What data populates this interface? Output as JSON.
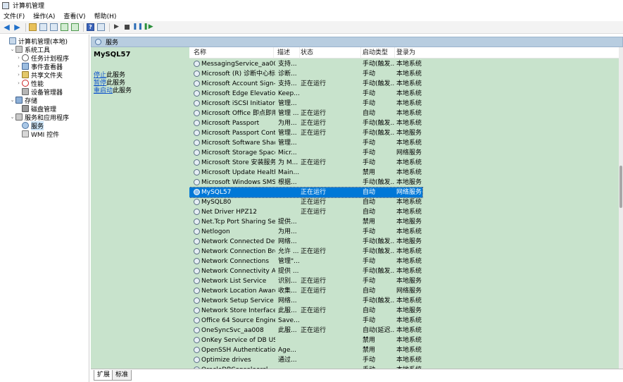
{
  "window": {
    "title": "计算机管理"
  },
  "menu": [
    "文件(F)",
    "操作(A)",
    "查看(V)",
    "帮助(H)"
  ],
  "toolbar": {
    "icons": [
      "back-arrow-icon",
      "forward-arrow-icon",
      "up-folder-icon",
      "console-tree-icon",
      "properties-icon",
      "refresh-icon",
      "export-icon",
      "help-icon",
      "view-icon",
      "start-service-icon",
      "stop-service-icon",
      "pause-service-icon",
      "restart-service-icon"
    ]
  },
  "tree": [
    {
      "label": "计算机管理(本地)",
      "level": 0,
      "twisty": "",
      "icon": "computer-icon"
    },
    {
      "label": "系统工具",
      "level": 1,
      "twisty": "v",
      "icon": "tools-icon"
    },
    {
      "label": "任务计划程序",
      "level": 2,
      "twisty": ">",
      "icon": "task-scheduler-icon"
    },
    {
      "label": "事件查看器",
      "level": 2,
      "twisty": ">",
      "icon": "event-viewer-icon"
    },
    {
      "label": "共享文件夹",
      "level": 2,
      "twisty": ">",
      "icon": "shared-folder-icon"
    },
    {
      "label": "性能",
      "level": 2,
      "twisty": ">",
      "icon": "performance-icon"
    },
    {
      "label": "设备管理器",
      "level": 2,
      "twisty": "",
      "icon": "device-manager-icon"
    },
    {
      "label": "存储",
      "level": 1,
      "twisty": "v",
      "icon": "storage-icon"
    },
    {
      "label": "磁盘管理",
      "level": 2,
      "twisty": "",
      "icon": "disk-management-icon"
    },
    {
      "label": "服务和应用程序",
      "level": 1,
      "twisty": "v",
      "icon": "services-apps-icon"
    },
    {
      "label": "服务",
      "level": 2,
      "twisty": "",
      "icon": "services-icon",
      "selected": true
    },
    {
      "label": "WMI 控件",
      "level": 2,
      "twisty": "",
      "icon": "wmi-icon"
    }
  ],
  "content_header": {
    "title": "服务"
  },
  "description": {
    "service_name": "MySQL57",
    "actions": [
      {
        "link": "停止",
        "rest": "此服务"
      },
      {
        "link": "暂停",
        "rest": "此服务"
      },
      {
        "link": "重启动",
        "rest": "此服务"
      }
    ]
  },
  "columns": [
    "名称",
    "描述",
    "状态",
    "启动类型",
    "登录为"
  ],
  "services": [
    {
      "name": "MessagingService_aa008",
      "desc": "支持...",
      "status": "",
      "startup": "手动(触发...",
      "logon": "本地系统"
    },
    {
      "name": "Microsoft (R) 诊断中心标准...",
      "desc": "诊断...",
      "status": "",
      "startup": "手动",
      "logon": "本地系统"
    },
    {
      "name": "Microsoft Account Sign-in ...",
      "desc": "支持...",
      "status": "正在运行",
      "startup": "手动(触发...",
      "logon": "本地系统"
    },
    {
      "name": "Microsoft Edge Elevation S...",
      "desc": "Keep...",
      "status": "",
      "startup": "手动",
      "logon": "本地系统"
    },
    {
      "name": "Microsoft iSCSI Initiator Ser...",
      "desc": "管理...",
      "status": "",
      "startup": "手动",
      "logon": "本地系统"
    },
    {
      "name": "Microsoft Office 即点即用...",
      "desc": "管理 ...",
      "status": "正在运行",
      "startup": "自动",
      "logon": "本地系统"
    },
    {
      "name": "Microsoft Passport",
      "desc": "为用...",
      "status": "正在运行",
      "startup": "手动(触发...",
      "logon": "本地系统"
    },
    {
      "name": "Microsoft Passport Container",
      "desc": "管理...",
      "status": "正在运行",
      "startup": "手动(触发...",
      "logon": "本地服务"
    },
    {
      "name": "Microsoft Software Shado...",
      "desc": "管理...",
      "status": "",
      "startup": "手动",
      "logon": "本地系统"
    },
    {
      "name": "Microsoft Storage Spaces S...",
      "desc": "Micr...",
      "status": "",
      "startup": "手动",
      "logon": "网络服务"
    },
    {
      "name": "Microsoft Store 安装服务",
      "desc": "为 M...",
      "status": "正在运行",
      "startup": "手动",
      "logon": "本地系统"
    },
    {
      "name": "Microsoft Update Health S...",
      "desc": "Main...",
      "status": "",
      "startup": "禁用",
      "logon": "本地系统"
    },
    {
      "name": "Microsoft Windows SMS 路...",
      "desc": "根据...",
      "status": "",
      "startup": "手动(触发...",
      "logon": "本地服务"
    },
    {
      "name": "MySQL57",
      "desc": "",
      "status": "正在运行",
      "startup": "自动",
      "logon": "网络服务",
      "selected": true
    },
    {
      "name": "MySQL80",
      "desc": "",
      "status": "正在运行",
      "startup": "自动",
      "logon": "本地系统"
    },
    {
      "name": "Net Driver HPZ12",
      "desc": "",
      "status": "正在运行",
      "startup": "自动",
      "logon": "本地系统"
    },
    {
      "name": "Net.Tcp Port Sharing Service",
      "desc": "提供...",
      "status": "",
      "startup": "禁用",
      "logon": "本地服务"
    },
    {
      "name": "Netlogon",
      "desc": "为用...",
      "status": "",
      "startup": "手动",
      "logon": "本地系统"
    },
    {
      "name": "Network Connected Devic...",
      "desc": "网络...",
      "status": "",
      "startup": "手动(触发...",
      "logon": "本地服务"
    },
    {
      "name": "Network Connection Broker",
      "desc": "允许 ...",
      "status": "正在运行",
      "startup": "手动(触发...",
      "logon": "本地系统"
    },
    {
      "name": "Network Connections",
      "desc": "管理\"...",
      "status": "",
      "startup": "手动",
      "logon": "本地系统"
    },
    {
      "name": "Network Connectivity Assis...",
      "desc": "提供 ...",
      "status": "",
      "startup": "手动(触发...",
      "logon": "本地系统"
    },
    {
      "name": "Network List Service",
      "desc": "识别...",
      "status": "正在运行",
      "startup": "手动",
      "logon": "本地服务"
    },
    {
      "name": "Network Location Awarene...",
      "desc": "收集...",
      "status": "正在运行",
      "startup": "自动",
      "logon": "网络服务"
    },
    {
      "name": "Network Setup Service",
      "desc": "网络...",
      "status": "",
      "startup": "手动(触发...",
      "logon": "本地系统"
    },
    {
      "name": "Network Store Interface Se...",
      "desc": "此服...",
      "status": "正在运行",
      "startup": "自动",
      "logon": "本地服务"
    },
    {
      "name": "Office 64 Source Engine",
      "desc": "Save...",
      "status": "",
      "startup": "手动",
      "logon": "本地系统"
    },
    {
      "name": "OneSyncSvc_aa008",
      "desc": "此服...",
      "status": "正在运行",
      "startup": "自动(延迟...",
      "logon": "本地系统"
    },
    {
      "name": "OnKey Service of DB USB ...",
      "desc": "",
      "status": "",
      "startup": "禁用",
      "logon": "本地系统"
    },
    {
      "name": "OpenSSH Authentication ...",
      "desc": "Age...",
      "status": "",
      "startup": "禁用",
      "logon": "本地系统"
    },
    {
      "name": "Optimize drives",
      "desc": "通过...",
      "status": "",
      "startup": "手动",
      "logon": "本地系统"
    },
    {
      "name": "OracleDBConsoleorcl",
      "desc": "",
      "status": "",
      "startup": "手动",
      "logon": "本地系统"
    }
  ],
  "tabs": [
    "扩展",
    "标准"
  ],
  "colors": {
    "list_bg": "#c8e3cc",
    "selection": "#0078d7",
    "header_bar": "#b8cde0"
  }
}
